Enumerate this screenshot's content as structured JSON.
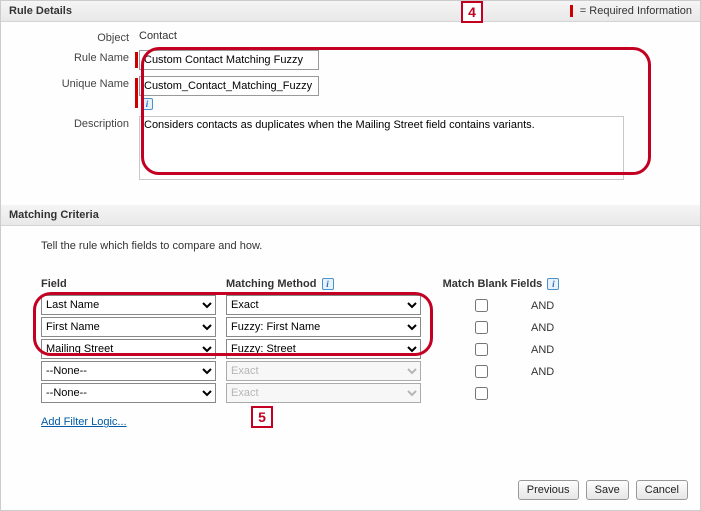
{
  "header": {
    "title": "Rule Details",
    "required_info": "= Required Information"
  },
  "form": {
    "object_label": "Object",
    "object_value": "Contact",
    "rule_name_label": "Rule Name",
    "rule_name_value": "Custom Contact Matching Fuzzy",
    "unique_name_label": "Unique Name",
    "unique_name_value": "Custom_Contact_Matching_Fuzzy",
    "description_label": "Description",
    "description_value": "Considers contacts as duplicates when the Mailing Street field contains variants."
  },
  "criteria": {
    "title": "Matching Criteria",
    "intro": "Tell the rule which fields to compare and how.",
    "headers": {
      "field": "Field",
      "method": "Matching Method",
      "blank": "Match Blank Fields"
    },
    "and_label": "AND",
    "rows": [
      {
        "field": "Last Name",
        "method": "Exact",
        "disabled": false
      },
      {
        "field": "First Name",
        "method": "Fuzzy: First Name",
        "disabled": false
      },
      {
        "field": "Mailing Street",
        "method": "Fuzzy: Street",
        "disabled": false
      },
      {
        "field": "--None--",
        "method": "Exact",
        "disabled": true
      },
      {
        "field": "--None--",
        "method": "Exact",
        "disabled": true
      }
    ],
    "filter_logic": "Add Filter Logic..."
  },
  "callouts": {
    "c4": "4",
    "c5": "5"
  },
  "buttons": {
    "previous": "Previous",
    "save": "Save",
    "cancel": "Cancel"
  },
  "icons": {
    "info": "i"
  }
}
